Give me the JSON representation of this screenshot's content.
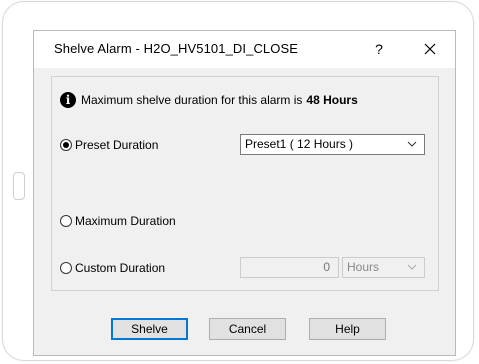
{
  "dialog": {
    "title": "Shelve Alarm - H2O_HV5101_DI_CLOSE",
    "help_glyph": "?",
    "info": {
      "text": "Maximum shelve duration for this alarm is",
      "bold_value": "48 Hours",
      "icon": "info-icon"
    },
    "options": {
      "preset": {
        "label": "Preset Duration",
        "selected": true,
        "dropdown_value": "Preset1 ( 12 Hours )"
      },
      "maximum": {
        "label": "Maximum Duration",
        "selected": false
      },
      "custom": {
        "label": "Custom Duration",
        "selected": false,
        "value": "0",
        "unit": "Hours"
      }
    },
    "buttons": {
      "shelve": "Shelve",
      "cancel": "Cancel",
      "help": "Help"
    }
  },
  "colors": {
    "dialog_bg": "#f0f0f0",
    "default_button_border": "#0078d7",
    "button_bg": "#e1e1e1"
  }
}
